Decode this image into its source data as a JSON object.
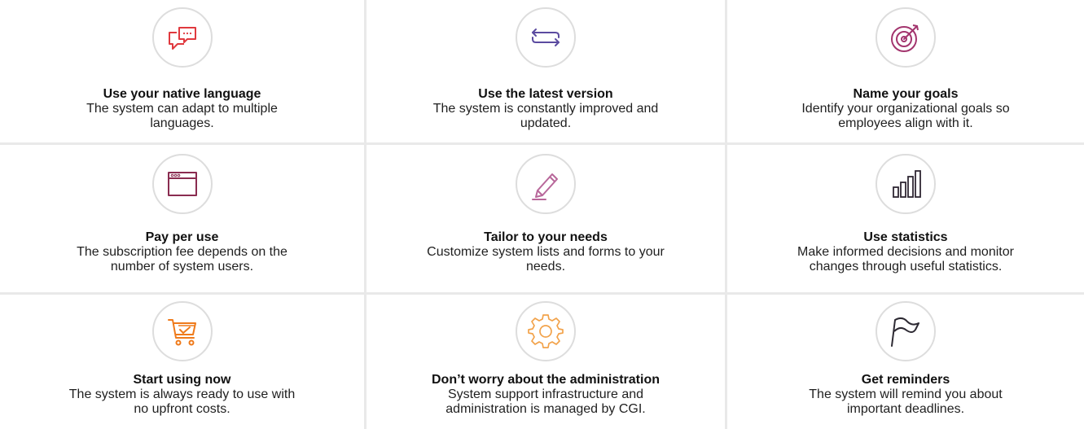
{
  "features": [
    {
      "title": "Use your native language",
      "description": "The system can adapt to multiple languages.",
      "icon": "speech-bubbles-icon",
      "icon_color": "#e0393e"
    },
    {
      "title": "Use the latest version",
      "description": "The system is constantly improved and updated.",
      "icon": "refresh-arrows-icon",
      "icon_color": "#5b4ba0"
    },
    {
      "title": "Name your goals",
      "description": "Identify your organizational goals so employees align with it.",
      "icon": "target-icon",
      "icon_color": "#a3356e"
    },
    {
      "title": "Pay per use",
      "description": "The subscription fee depends on the number of system users.",
      "icon": "browser-window-icon",
      "icon_color": "#8a2c50"
    },
    {
      "title": "Tailor to your needs",
      "description": "Customize system lists and forms to your needs.",
      "icon": "pencil-icon",
      "icon_color": "#b8679a"
    },
    {
      "title": "Use statistics",
      "description": "Make informed decisions and monitor changes through useful statistics.",
      "icon": "bar-chart-icon",
      "icon_color": "#2f2733"
    },
    {
      "title": "Start using now",
      "description": "The system is always ready to use with no upfront costs.",
      "icon": "shopping-cart-icon",
      "icon_color": "#ef7a1a"
    },
    {
      "title": "Don’t worry about the administration",
      "description": "System support infrastructure and administration is managed by CGI.",
      "icon": "gear-icon",
      "icon_color": "#f2a24a"
    },
    {
      "title": "Get reminders",
      "description": "The system will remind you about important deadlines.",
      "icon": "flag-icon",
      "icon_color": "#2d2a33"
    }
  ]
}
